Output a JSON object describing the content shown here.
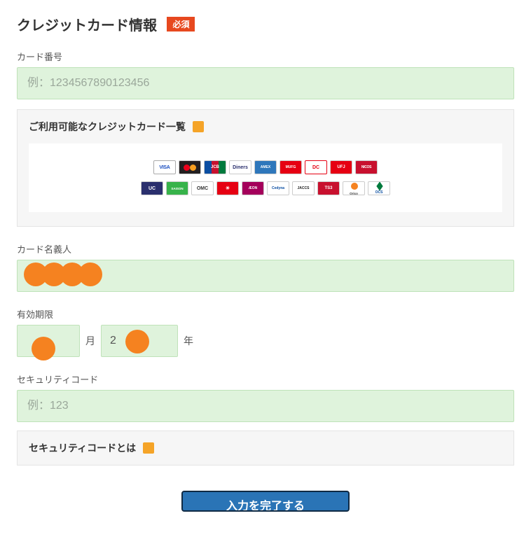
{
  "section": {
    "title": "クレジットカード情報",
    "required_label": "必須"
  },
  "card_number": {
    "label": "カード番号",
    "placeholder": "例：1234567890123456",
    "value": ""
  },
  "available_cards": {
    "title": "ご利用可能なクレジットカード一覧",
    "logos_row1": [
      "VISA",
      "",
      "JCB",
      "Diners",
      "AMEX",
      "MUFG",
      "DC",
      "UFJ",
      "NICOS"
    ],
    "logos_row2": [
      "UC",
      "SAISON",
      "OMC",
      "",
      "ÆON",
      "Cedyna",
      "JACCS",
      "TS3",
      "Orico",
      "OCS"
    ]
  },
  "card_holder": {
    "label": "カード名義人",
    "value": ""
  },
  "expiry": {
    "label": "有効期限",
    "month_value": "",
    "month_unit": "月",
    "year_prefix": "2",
    "year_value": "",
    "year_unit": "年"
  },
  "security_code": {
    "label": "セキュリティコード",
    "placeholder": "例：123",
    "value": ""
  },
  "security_help": {
    "title": "セキュリティコードとは"
  },
  "submit": {
    "label": "入力を完了する"
  }
}
